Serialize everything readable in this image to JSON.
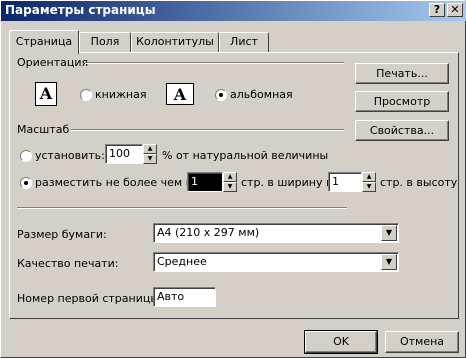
{
  "window": {
    "title": "Параметры страницы",
    "help_label": "?",
    "close_label": "✕"
  },
  "tabs": [
    {
      "label": "Страница",
      "active": true
    },
    {
      "label": "Поля",
      "active": false
    },
    {
      "label": "Колонтитулы",
      "active": false
    },
    {
      "label": "Лист",
      "active": false
    }
  ],
  "orientation": {
    "group_label": "Ориентация",
    "portrait_label": "книжная",
    "landscape_label": "альбомная",
    "icon_letter": "A",
    "selected": "landscape"
  },
  "scale": {
    "group_label": "Масштаб",
    "set_label": "установить:",
    "set_value": "100",
    "set_suffix": "% от натуральной величины",
    "fit_label": "разместить не более чем на:",
    "fit_width_value": "1",
    "fit_width_suffix": "стр. в ширину и",
    "fit_height_value": "1",
    "fit_height_suffix": "стр. в высоту",
    "selected": "fit"
  },
  "paper_size": {
    "label": "Размер бумаги:",
    "value": "A4 (210 x 297 мм)"
  },
  "print_quality": {
    "label": "Качество печати:",
    "value": "Среднее"
  },
  "first_page": {
    "label": "Номер первой страницы:",
    "value": "Авто"
  },
  "side_buttons": {
    "print": "Печать...",
    "preview": "Просмотр",
    "properties": "Свойства..."
  },
  "footer": {
    "ok": "OK",
    "cancel": "Отмена"
  }
}
